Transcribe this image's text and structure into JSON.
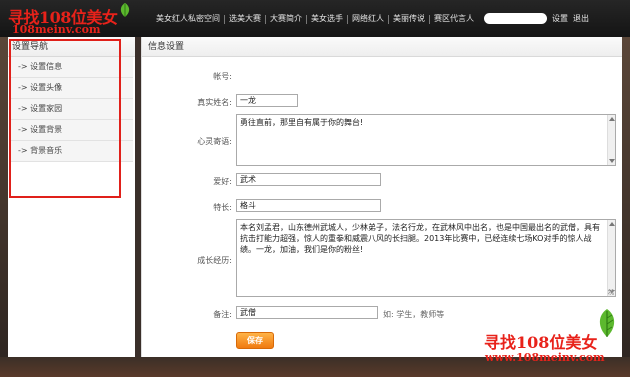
{
  "logo": {
    "main": "寻找108位美女",
    "sub": "108meinv.com"
  },
  "nav": {
    "items": [
      "美女红人私密空间",
      "选美大赛",
      "大赛简介",
      "美女选手",
      "网络红人",
      "美丽传说",
      "赛区代言人"
    ]
  },
  "user": {
    "settings": "设置",
    "logout": "退出"
  },
  "sidebar": {
    "title": "设置导航",
    "items": [
      {
        "label": "-> 设置信息"
      },
      {
        "label": "-> 设置头像"
      },
      {
        "label": "-> 设置家园"
      },
      {
        "label": "-> 设置背景"
      },
      {
        "label": "-> 背景音乐"
      }
    ]
  },
  "main": {
    "title": "信息设置",
    "account": {
      "label": "帐号:",
      "value": ""
    },
    "real_name": {
      "label": "真实姓名:",
      "value": "一龙"
    },
    "motto": {
      "label": "心灵寄语:",
      "value": "勇往直前，那里自有属于你的舞台!"
    },
    "hobby": {
      "label": "爱好:",
      "value": "武术"
    },
    "specialty": {
      "label": "特长:",
      "value": "格斗"
    },
    "history": {
      "label": "成长经历:",
      "value": "本名刘孟君，山东德州武城人，少林弟子，法名行龙，在武林风中出名，也是中国最出名的武僧，具有抗击打能力超强，惊人的重拳和威震八风的长扫腿。2013年比赛中，已经连续七场KO对手的惊人战绩。一龙，加油，我们是你的粉丝!"
    },
    "note": {
      "label": "备注:",
      "value": "武僧",
      "hint": "如: 学生，教师等"
    },
    "save_label": "保存"
  },
  "watermark": {
    "main": "寻找108位美女",
    "sub": "www.108meinv.com"
  },
  "colors": {
    "accent": "#e8221a",
    "button": "#f28a1e",
    "header": "#1c1c1c"
  }
}
